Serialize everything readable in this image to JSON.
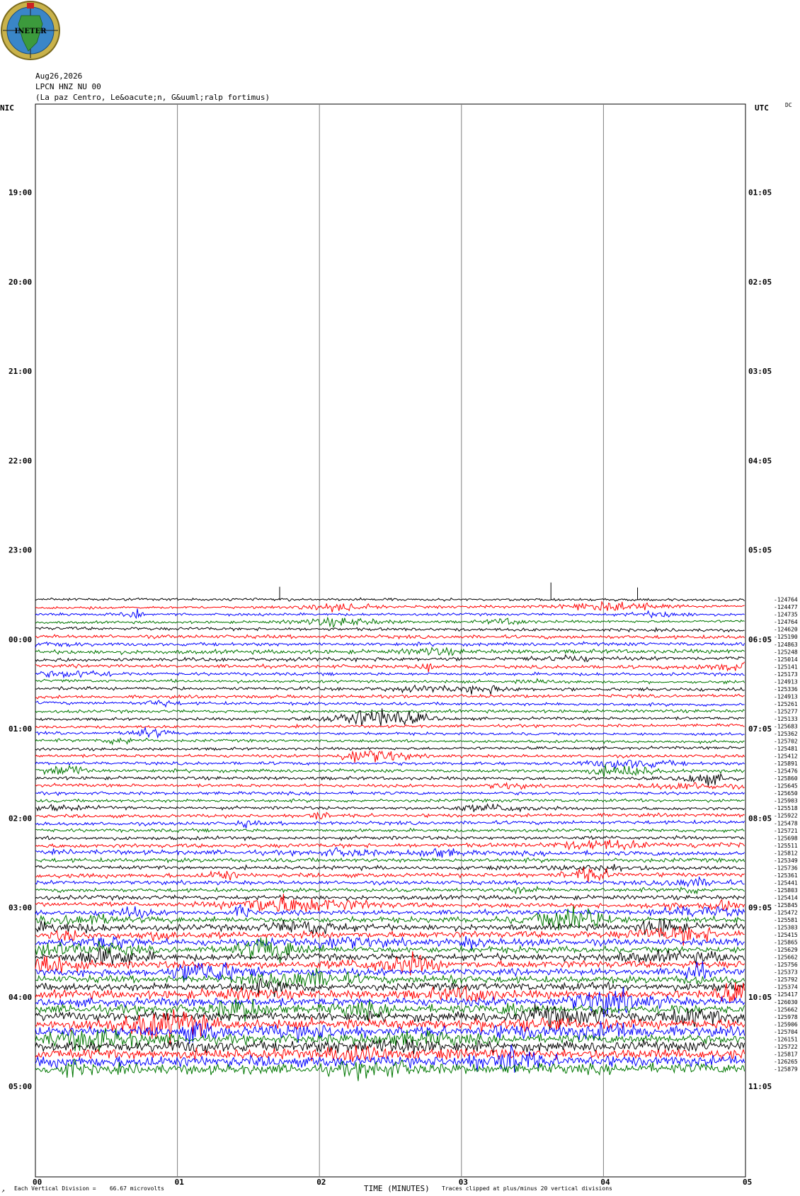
{
  "header": {
    "logo_text": "INETER",
    "date": "Aug26,2026",
    "station": "LPCN HNZ NU 00",
    "location": "(La paz Centro, Le&oacute;n, G&uuml;ralp fortimus)",
    "left_tz": "NIC",
    "right_tz": "UTC",
    "dc_label": "DC"
  },
  "footer": {
    "scale_note": "Each Vertical Division =    66.67 microvolts",
    "clip_note": "Traces clipped at plus/minus 20 vertical divisions",
    "corner_mark": "↗"
  },
  "colors": {
    "trace_cycle": [
      "#000000",
      "#ff0000",
      "#0000ff",
      "#007700"
    ],
    "grid": "#808080"
  },
  "chart_data": {
    "type": "line",
    "subtype": "helicorder",
    "xlabel": "TIME (MINUTES)",
    "x_ticks": [
      "00",
      "01",
      "02",
      "03",
      "04",
      "05"
    ],
    "xlim": [
      0,
      5
    ],
    "row_minutes": 5,
    "hour_labels_local": [
      "19:00",
      "20:00",
      "21:00",
      "22:00",
      "23:00",
      "00:00",
      "01:00",
      "02:00",
      "03:00",
      "04:00",
      "05:00"
    ],
    "hour_labels_utc": [
      "01:05",
      "02:05",
      "03:05",
      "04:05",
      "05:05",
      "06:05",
      "07:05",
      "08:05",
      "09:05",
      "10:05",
      "11:05"
    ],
    "first_hour_row": 12,
    "trace_start_row": 66,
    "rows_total": 144,
    "trace_offsets": [
      "-124764",
      "-124477",
      "-124735",
      "-124764",
      "-124620",
      "-125190",
      "-124863",
      "-125248",
      "-125014",
      "-125141",
      "-125173",
      "-124913",
      "-125336",
      "-124913",
      "-125261",
      "-125277",
      "-125133",
      "-125683",
      "-125362",
      "-125702",
      "-125481",
      "-125412",
      "-125891",
      "-125476",
      "-125860",
      "-125645",
      "-125650",
      "-125903",
      "-125518",
      "-125922",
      "-125478",
      "-125721",
      "-125698",
      "-125511",
      "-125812",
      "-125349",
      "-125736",
      "-125361",
      "-125441",
      "-125803",
      "-125414",
      "-125845",
      "-125472",
      "-125581",
      "-125303",
      "-125415",
      "-125865",
      "-125629",
      "-125662",
      "-125756",
      "-125373",
      "-125792",
      "-125374",
      "-125417",
      "-126030",
      "-125662",
      "-125978",
      "-125906",
      "-125704",
      "-126151",
      "-125722",
      "-125817",
      "-126265",
      "-125879"
    ],
    "trace_amplitude_profile": [
      1,
      1,
      1,
      1,
      1.2,
      1.4,
      1.3,
      1.6,
      1.4,
      1.3,
      1.2,
      1.1,
      1.3,
      1.2,
      1.2,
      1.2,
      1.1,
      1.1,
      1.1,
      1.1,
      1.1,
      1.2,
      1.2,
      1.2,
      1.3,
      1.2,
      1.2,
      1.2,
      1.2,
      1.3,
      1.4,
      1.3,
      1.4,
      1.6,
      1.8,
      1.6,
      1.5,
      1.6,
      1.5,
      1.5,
      1.7,
      1.8,
      1.8,
      2.2,
      2.4,
      2.6,
      2.6,
      2.5,
      2.6,
      2.8,
      2.6,
      2.7,
      3.0,
      3.2,
      3.2,
      3.4,
      3.6,
      3.8,
      3.6,
      3.6,
      3.8,
      4.0,
      4.2,
      4.0
    ]
  }
}
